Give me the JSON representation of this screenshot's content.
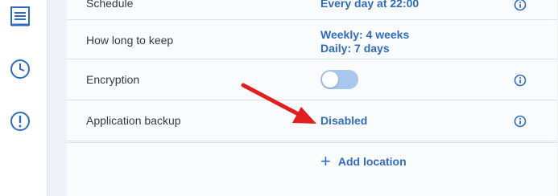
{
  "sidebar": {
    "icons": [
      "backup-list-icon",
      "clock-icon",
      "alert-icon"
    ]
  },
  "rows": {
    "schedule": {
      "label": "Schedule",
      "value": "Every day at 22:00"
    },
    "keep": {
      "label": "How long to keep",
      "value_line1": "Weekly: 4 weeks",
      "value_line2": "Daily: 7 days"
    },
    "encryption": {
      "label": "Encryption",
      "toggle_state": "off"
    },
    "app_backup": {
      "label": "Application backup",
      "value": "Disabled"
    }
  },
  "add_location": {
    "label": "Add location"
  },
  "colors": {
    "accent": "#2f6cc0",
    "toggle_off": "#a9c6ec",
    "annotation_arrow": "#e02020"
  }
}
